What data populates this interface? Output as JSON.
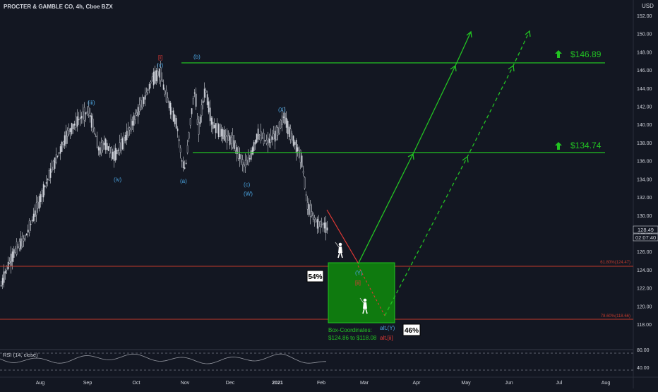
{
  "header": {
    "symbol_title": "PROCTER & GAMBLE CO, 4h, Cboe BZX",
    "currency": "USD"
  },
  "price_axis": {
    "ticks": [
      "152.00",
      "150.00",
      "148.00",
      "146.00",
      "144.00",
      "142.00",
      "140.00",
      "138.00",
      "136.00",
      "134.00",
      "132.00",
      "130.00",
      "128.00",
      "126.00",
      "124.00",
      "122.00",
      "120.00",
      "118.00"
    ],
    "last_price": "128.49",
    "countdown": "02:07:40"
  },
  "time_axis": {
    "ticks": [
      "Aug",
      "Sep",
      "Oct",
      "Nov",
      "Dec",
      "2021",
      "Feb",
      "Mar",
      "Apr",
      "May",
      "Jun",
      "Jul",
      "Aug"
    ]
  },
  "rsi": {
    "label": "RSI (14, close)",
    "ticks": [
      "80.00",
      "40.00"
    ]
  },
  "targets": [
    {
      "label": "$146.89",
      "value": 146.89
    },
    {
      "label": "$134.74",
      "value": 134.74
    }
  ],
  "fib_levels": [
    {
      "label": "61.80%(124.47)",
      "value": 124.47
    },
    {
      "label": "78.60%(118.66)",
      "value": 118.66
    }
  ],
  "probabilities": {
    "main": "54%",
    "alt": "46%"
  },
  "box": {
    "caption_line1": "Box-Coordinates:",
    "caption_line2": "$124.86 to $118.08",
    "top": 124.86,
    "bottom": 118.08
  },
  "wave_labels": {
    "i_bracket": "[i]",
    "v": "(v)",
    "iii": "(iii)",
    "iv": "(iv)",
    "a": "(a)",
    "b": "(b)",
    "c": "(c)",
    "w": "(W)",
    "x": "(X)",
    "y": "(Y)",
    "ii": "[ii]",
    "alt_y": "alt.(Y)",
    "alt_ii": "alt.[ii]"
  },
  "colors": {
    "background": "#131722",
    "candle": "#d1d4dc",
    "target_line": "#22c322",
    "fib_line": "#c0392b",
    "box_fill": "#0f7a0f",
    "wave_label": "#4aa3df",
    "bracket_label": "#e53935"
  },
  "chart_data": {
    "type": "line",
    "title": "PROCTER & GAMBLE CO, 4h, Cboe BZX",
    "x": [
      "Aug",
      "Sep",
      "Oct",
      "Nov",
      "Dec",
      "2021",
      "Feb"
    ],
    "series": [
      {
        "values": [
          125,
          141,
          145.5,
          137,
          141,
          140,
          129
        ]
      }
    ],
    "ylim": [
      117,
      153
    ],
    "horizontal_levels": [
      146.89,
      134.74,
      124.47,
      118.66
    ],
    "projection_main": [
      [
        125,
        148
      ],
      [
        148,
        150.5
      ]
    ],
    "projection_alt": [
      [
        118.8,
        150.5
      ]
    ]
  }
}
